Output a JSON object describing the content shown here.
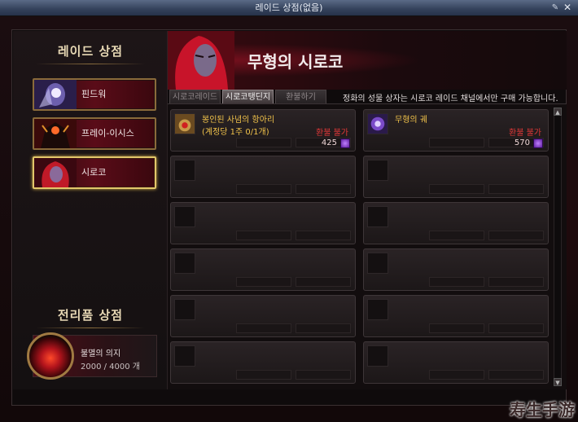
{
  "window": {
    "title": "레이드 상점(없음)"
  },
  "left_panel": {
    "raid_shop_title": "레이드 상점",
    "raids": [
      {
        "label": "핀드워",
        "selected": false
      },
      {
        "label": "프레이-이시스",
        "selected": false
      },
      {
        "label": "시로코",
        "selected": true
      }
    ],
    "loot_shop_title": "전리품 상점",
    "consumable": {
      "name": "불멸의 의지",
      "count": "2000 / 4000 개"
    }
  },
  "right_panel": {
    "banner_title": "무형의 시로코",
    "tabs": [
      {
        "label": "시로코레이드",
        "active": false
      },
      {
        "label": "시로코탱딘지",
        "active": true
      },
      {
        "label": "환불하기",
        "active": false
      }
    ],
    "notice": "정화의 성물 상자는 시로코 레이드 채널에서만 구매 가능합니다.",
    "items": [
      {
        "name": "봉인된 사념의 항아리",
        "sub": "(계정당 1주 0/1개)",
        "refund": "환불 불가",
        "price": "425"
      },
      {
        "name": "무형의 궤",
        "sub": "",
        "refund": "환불 불가",
        "price": "570"
      }
    ]
  },
  "watermark": "寿生手游"
}
